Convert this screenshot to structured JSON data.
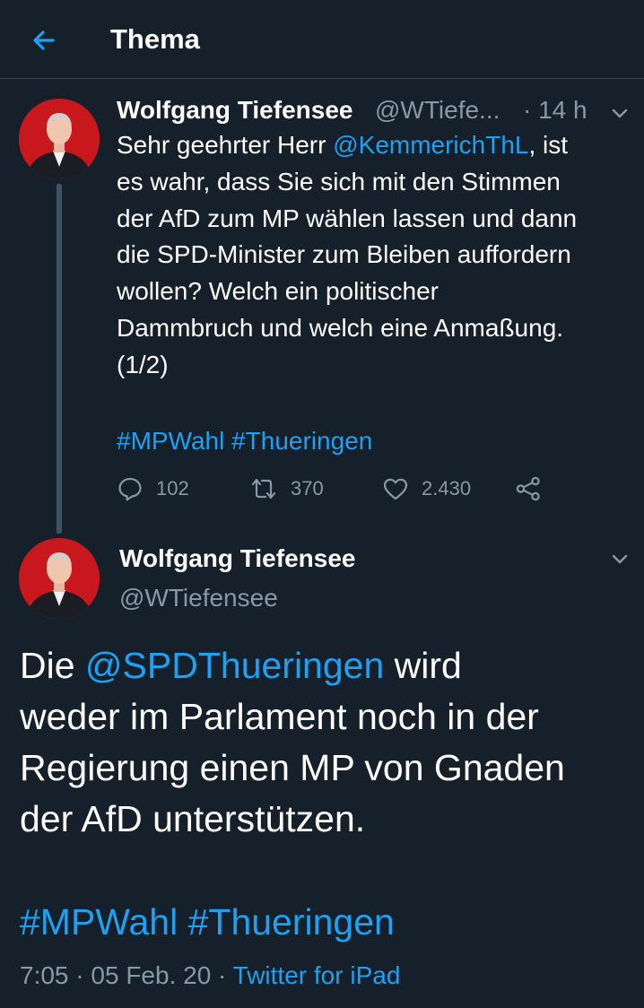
{
  "header": {
    "title": "Thema",
    "back_icon": "arrow-left-icon"
  },
  "colors": {
    "background": "#15202b",
    "accent": "#1da1f2",
    "secondary_text": "#8899a6",
    "avatar_bg": "#c8171d"
  },
  "tweet1": {
    "author_name": "Wolfgang Tiefensee",
    "handle": "@WTiefe...",
    "time": "· 14 h",
    "text_lines": [
      [
        "Sehr geehrter Herr ",
        "@KemmerichThL",
        ", ist"
      ],
      [
        "es wahr, dass Sie sich mit den Stimmen"
      ],
      [
        "der AfD zum MP wählen lassen und dann"
      ],
      [
        "die SPD-Minister zum Bleiben auffordern"
      ],
      [
        "wollen? Welch ein politischer"
      ],
      [
        "Dammbruch und welch eine Anmaßung."
      ],
      [
        "(1/2)"
      ]
    ],
    "hashtags": [
      "#MPWahl",
      "#Thueringen"
    ],
    "actions": {
      "reply_count": "102",
      "retweet_count": "370",
      "like_count": "2.430"
    }
  },
  "tweet2": {
    "author_name": "Wolfgang Tiefensee",
    "handle": "@WTiefensee",
    "text_lines": [
      [
        "Die ",
        "@SPDThueringen",
        " wird"
      ],
      [
        "weder im Parlament noch in der"
      ],
      [
        "Regierung einen MP von Gnaden"
      ],
      [
        "der AfD unterstützen."
      ]
    ],
    "hashtags": [
      "#MPWahl",
      "#Thueringen"
    ],
    "time": "7:05",
    "date": "05 Feb. 20",
    "source": "Twitter for iPad"
  }
}
